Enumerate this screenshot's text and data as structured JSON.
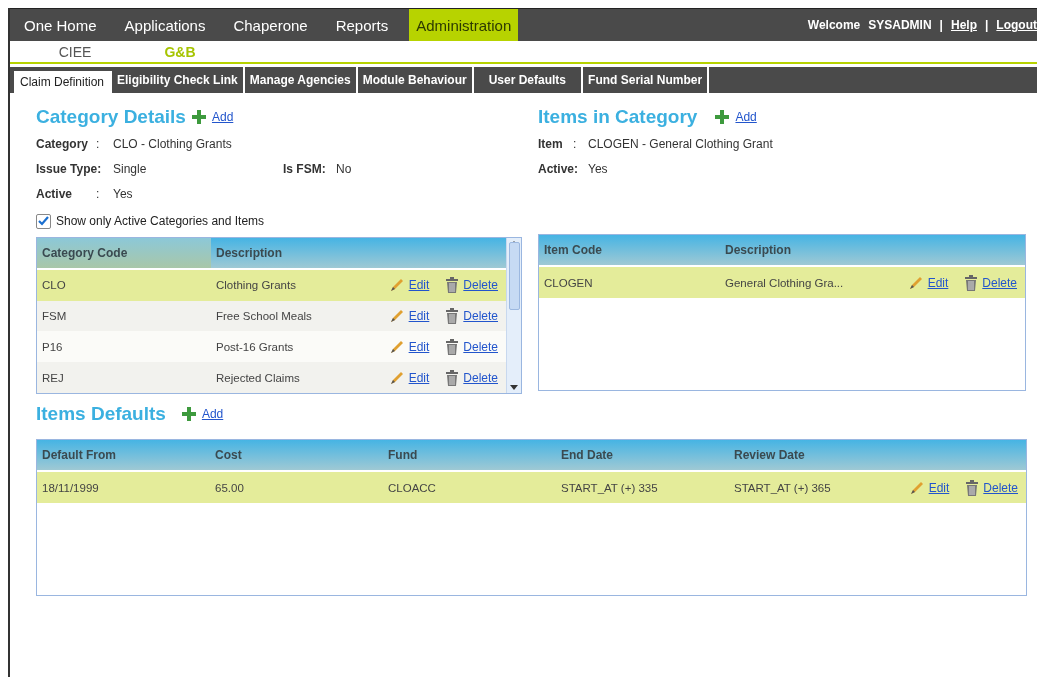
{
  "nav": {
    "items": [
      {
        "label": "One Home",
        "selected": false
      },
      {
        "label": "Applications",
        "selected": false
      },
      {
        "label": "Chaperone",
        "selected": false
      },
      {
        "label": "Reports",
        "selected": false
      },
      {
        "label": "Administration",
        "selected": true
      }
    ],
    "welcome": "Welcome",
    "user": "SYSADMIN",
    "separator": "|",
    "links": [
      "Help",
      "Logout"
    ]
  },
  "subnav": [
    {
      "label": "CIEE",
      "selected": false
    },
    {
      "label": "G&B",
      "selected": true
    }
  ],
  "tabs": [
    {
      "label": "Claim Definition",
      "selected": true
    },
    {
      "label": "Eligibility Check Link",
      "selected": false
    },
    {
      "label": "Manage Agencies",
      "selected": false
    },
    {
      "label": "Module Behaviour",
      "selected": false
    },
    {
      "label": "User Defaults",
      "selected": false
    },
    {
      "label": "Fund Serial Number",
      "selected": false
    }
  ],
  "category_details": {
    "title": "Category Details",
    "add": "Add",
    "fields": [
      {
        "label": "Category",
        "sep": ":",
        "value": "CLO - Clothing Grants"
      },
      {
        "label": "Issue Type:",
        "value": "Single",
        "extra_label": "Is FSM:",
        "extra_value": "No"
      },
      {
        "label": "Active",
        "sep": ":",
        "value": "Yes"
      }
    ],
    "filter": {
      "label": "Show only Active Categories and Items",
      "checked": true
    },
    "table": {
      "columns": [
        "Category Code",
        "Description"
      ],
      "rows": [
        {
          "cells": [
            "CLO",
            "Clothing Grants"
          ],
          "edit": "Edit",
          "delete": "Delete",
          "selected": true
        },
        {
          "cells": [
            "FSM",
            "Free School Meals"
          ],
          "edit": "Edit",
          "delete": "Delete",
          "selected": false
        },
        {
          "cells": [
            "P16",
            "Post-16 Grants"
          ],
          "edit": "Edit",
          "delete": "Delete",
          "selected": false
        },
        {
          "cells": [
            "REJ",
            "Rejected Claims"
          ],
          "edit": "Edit",
          "delete": "Delete",
          "selected": false
        }
      ]
    }
  },
  "items_in_category": {
    "title": "Items in Category",
    "add": "Add",
    "fields": [
      {
        "label": "Item",
        "sep": ":",
        "value": "CLOGEN - General Clothing Grant"
      },
      {
        "label": "Active:",
        "value": "Yes"
      }
    ],
    "table": {
      "columns": [
        "Item Code",
        "Description"
      ],
      "rows": [
        {
          "cells": [
            "CLOGEN",
            "General Clothing Gra..."
          ],
          "edit": "Edit",
          "delete": "Delete",
          "selected": true
        }
      ]
    }
  },
  "items_defaults": {
    "title": "Items Defaults",
    "add": "Add",
    "table": {
      "columns": [
        "Default From",
        "Cost",
        "Fund",
        "End Date",
        "Review Date"
      ],
      "rows": [
        {
          "cells": [
            "18/11/1999",
            "65.00",
            "CLOACC",
            "START_AT (+) 335",
            "START_AT (+) 365"
          ],
          "edit": "Edit",
          "delete": "Delete",
          "selected": true
        }
      ]
    }
  }
}
